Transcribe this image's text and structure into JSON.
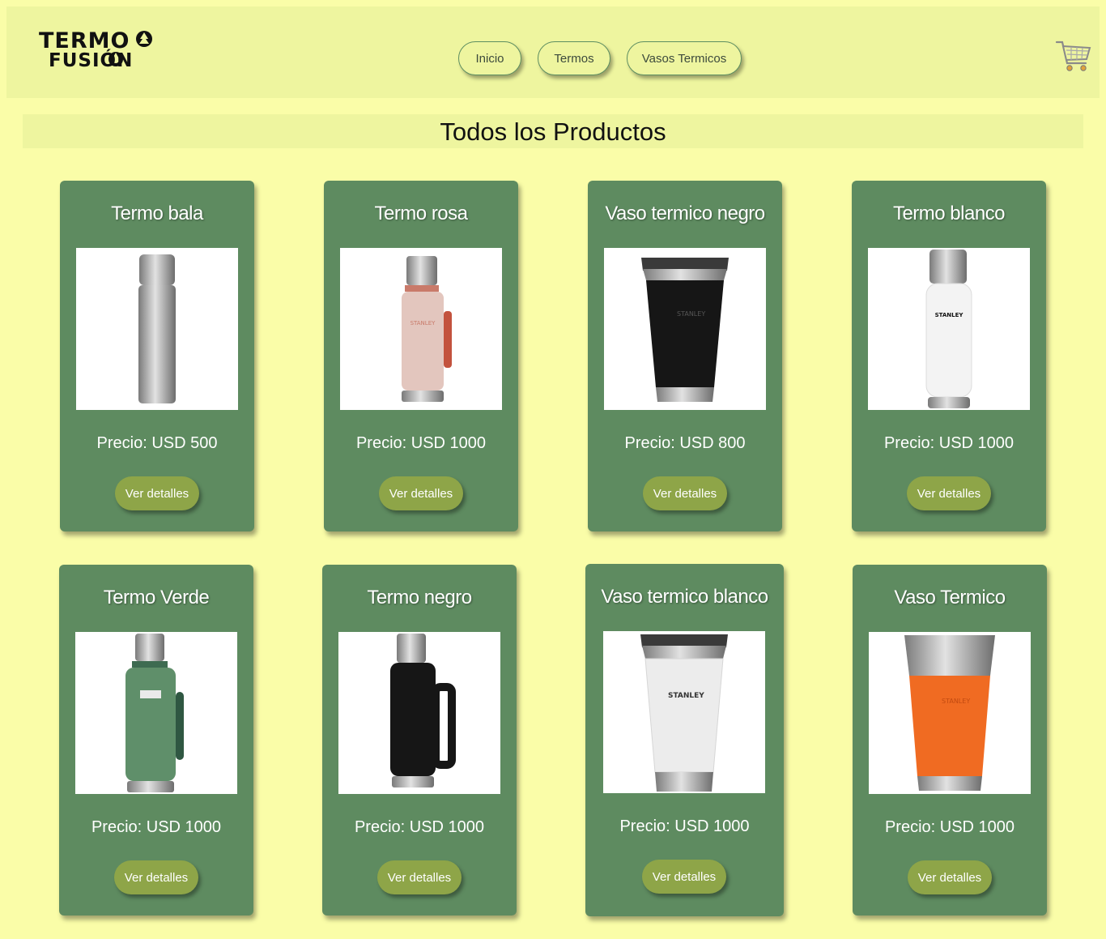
{
  "brand": {
    "line1": "TERMO",
    "line2": "FUSIÓN"
  },
  "nav": {
    "items": [
      "Inicio",
      "Termos",
      "Vasos Termicos"
    ]
  },
  "cart": {
    "icon": "shopping-cart-icon"
  },
  "section": {
    "title": "Todos los Productos"
  },
  "products": [
    {
      "name": "Termo bala",
      "price": "Precio: USD 500",
      "button": "Ver detalles",
      "image": "termo-bala-image",
      "color": "#a9a9a9"
    },
    {
      "name": "Termo rosa",
      "price": "Precio: USD 1000",
      "button": "Ver detalles",
      "image": "termo-rosa-image",
      "color": "#e3c6be"
    },
    {
      "name": "Vaso termico negro",
      "price": "Precio: USD 800",
      "button": "Ver detalles",
      "image": "vaso-termico-negro-image",
      "color": "#161616"
    },
    {
      "name": "Termo blanco",
      "price": "Precio: USD 1000",
      "button": "Ver detalles",
      "image": "termo-blanco-image",
      "color": "#f3f3f3"
    },
    {
      "name": "Termo Verde",
      "price": "Precio: USD 1000",
      "button": "Ver detalles",
      "image": "termo-verde-image",
      "color": "#5f8f6a"
    },
    {
      "name": "Termo negro",
      "price": "Precio: USD 1000",
      "button": "Ver detalles",
      "image": "termo-negro-image",
      "color": "#161616"
    },
    {
      "name": "Vaso termico blanco",
      "price": "Precio: USD 1000",
      "button": "Ver detalles",
      "image": "vaso-termico-blanco-image",
      "color": "#ececec"
    },
    {
      "name": "Vaso Termico",
      "price": "Precio: USD 1000",
      "button": "Ver detalles",
      "image": "vaso-termico-naranja-image",
      "color": "#f06b22"
    }
  ]
}
